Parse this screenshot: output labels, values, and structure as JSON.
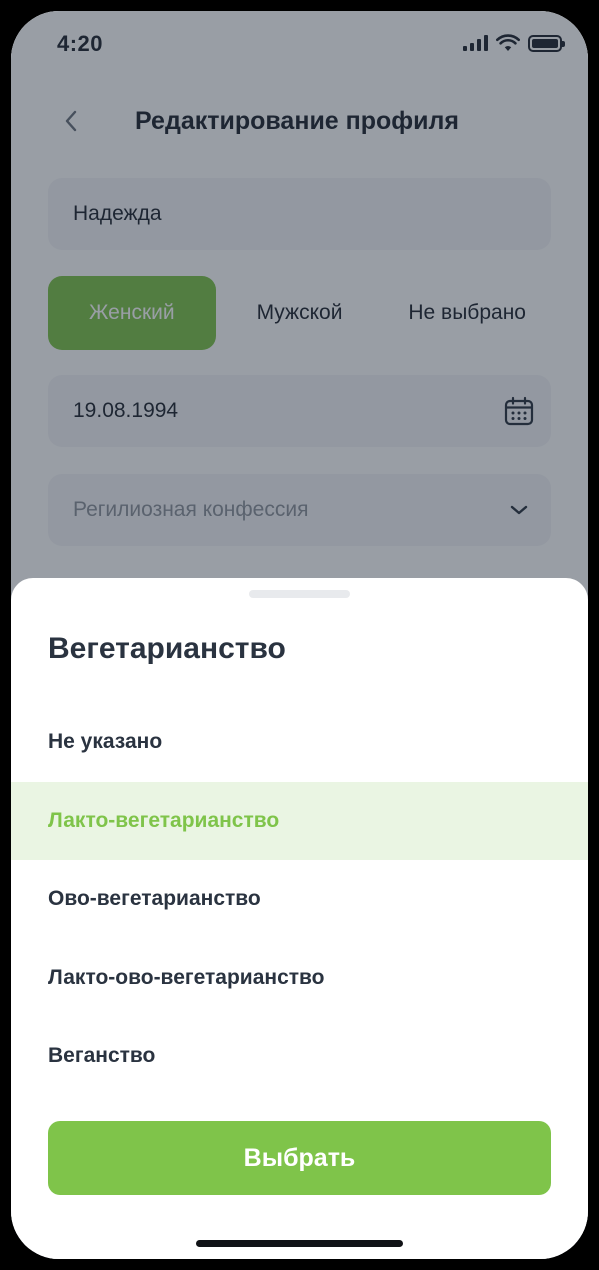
{
  "status_bar": {
    "time": "4:20"
  },
  "header": {
    "title": "Редактирование профиля"
  },
  "profile": {
    "name_value": "Надежда",
    "gender_options": [
      "Женский",
      "Мужской",
      "Не выбрано"
    ],
    "gender_selected": "Женский",
    "birthdate_value": "19.08.1994",
    "confession_placeholder": "Регилиозная конфессия"
  },
  "sheet": {
    "title": "Вегетарианство",
    "options": [
      {
        "label": "Не указано"
      },
      {
        "label": "Лакто-вегетарианство"
      },
      {
        "label": "Ово-вегетарианство"
      },
      {
        "label": "Лакто-ово-вегетарианство"
      },
      {
        "label": "Веганство"
      }
    ],
    "selected": "Лакто-вегетарианство",
    "button_label": "Выбрать"
  },
  "icons": {
    "back": "chevron-left-icon",
    "calendar": "calendar-icon",
    "dropdown": "chevron-down-icon",
    "signal": "cellular-signal-icon",
    "wifi": "wifi-icon",
    "battery": "battery-icon"
  },
  "colors": {
    "accent": "#7fc44a",
    "selected_bg": "#eaf5e3",
    "text_primary": "#2a3340",
    "overlay": "rgba(29,40,56,0.45)"
  }
}
